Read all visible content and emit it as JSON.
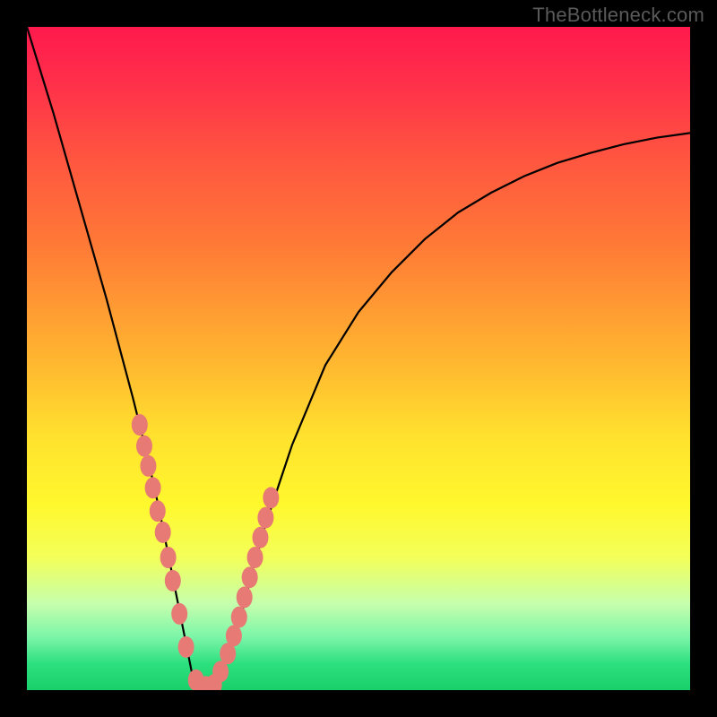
{
  "watermark": "TheBottleneck.com",
  "chart_data": {
    "type": "line",
    "title": "",
    "xlabel": "",
    "ylabel": "",
    "xlim": [
      0,
      100
    ],
    "ylim": [
      0,
      100
    ],
    "grid": false,
    "series": [
      {
        "name": "bottleneck-curve",
        "x": [
          0,
          4,
          8,
          12,
          16,
          18,
          20,
          22,
          23,
          24,
          25,
          26,
          27,
          28,
          30,
          32,
          34,
          36,
          40,
          45,
          50,
          55,
          60,
          65,
          70,
          75,
          80,
          85,
          90,
          95,
          100
        ],
        "values": [
          100,
          87,
          73,
          59,
          44,
          36,
          27,
          17,
          12,
          7,
          2,
          0,
          0,
          0,
          4,
          10,
          18,
          25,
          37,
          49,
          57,
          63,
          68,
          72,
          75,
          77.5,
          79.5,
          81,
          82.3,
          83.3,
          84
        ]
      }
    ],
    "markers": {
      "name": "highlight-points",
      "x": [
        17,
        17.7,
        18.3,
        19,
        19.7,
        20.5,
        21.3,
        22,
        23,
        24,
        25.5,
        27,
        28.2,
        29.2,
        30.3,
        31.2,
        32,
        32.8,
        33.6,
        34.4,
        35.2,
        36,
        36.8
      ],
      "values": [
        40,
        36.8,
        33.8,
        30.5,
        27,
        23.8,
        20,
        16.5,
        11.5,
        6.5,
        1.5,
        0.5,
        0.8,
        2.8,
        5.5,
        8.2,
        11,
        14,
        17,
        20,
        23,
        26,
        29
      ]
    },
    "gradient_stops": [
      {
        "pos": 0.0,
        "color": "#ff1a4d"
      },
      {
        "pos": 0.33,
        "color": "#ff7a36"
      },
      {
        "pos": 0.62,
        "color": "#ffe22e"
      },
      {
        "pos": 0.87,
        "color": "#c5ffad"
      },
      {
        "pos": 1.0,
        "color": "#18d06a"
      }
    ]
  }
}
